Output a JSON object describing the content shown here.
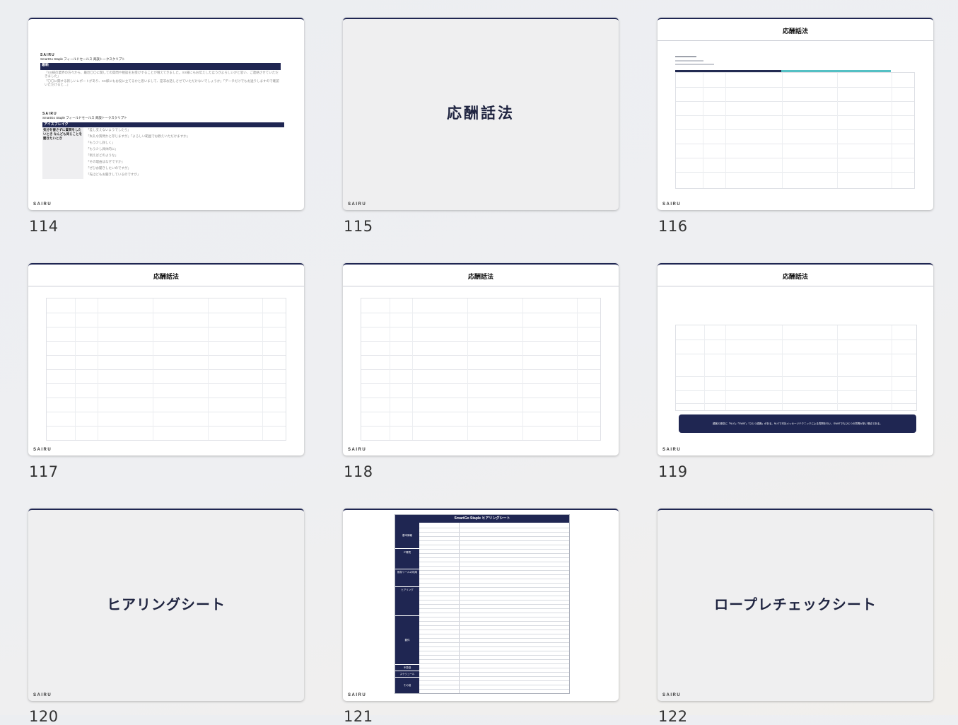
{
  "brand_footer": "SAIRU",
  "slides": [
    {
      "number": "114",
      "sections": [
        {
          "company": "SAIRU",
          "subtitle": "SmartGo Staple フィールドセールス 商談トークスクリプト",
          "bar": "最新",
          "lines": [
            "「XX様の業界の方々から、最近〇〇に関しての質問や相談をお受けすることが増えてきました。XX様にもお伝えしたほうがよろしいかと思い、ご連絡させていただきました」",
            "「〇〇に関する新しいレポートがあり、XX様にもお役に立てるかと思いまして、是非お話しさせていただけないでしょうか」「データだけでもお送りしますので確認いただけると…」"
          ]
        },
        {
          "company": "SAIRU",
          "subtitle": "SmartGo Staple フィールドセールス 商談トークスクリプト",
          "bar": "アイスブレイク",
          "side": "気分を害さずに質問をしたいとき なんども同じことを聞きたいとき",
          "lines": [
            "「差し支えないようでしたら」",
            "「失礼な質問かと存じますが」「よろしい範囲でお教えいただけますか」",
            "「もう少し詳しく」",
            "「もう少し具体的に」",
            "「例えばどのような」",
            "「その理由はなぜですか」",
            "「ぜひお聞きしたいのですが」",
            "「先ほどもお聞きしているのですが」"
          ]
        }
      ]
    },
    {
      "number": "115",
      "title": "応酬話法"
    },
    {
      "number": "116",
      "header": "応酬話法"
    },
    {
      "number": "117",
      "header": "応酬話法"
    },
    {
      "number": "118",
      "header": "応酬話法"
    },
    {
      "number": "119",
      "header": "応酬話法",
      "banner": "顧客の懸念に「NLO」「SWAT」「ひとつ認識」がある。NLOで本社メッセージテクニックによる質問を行い、SWATでもひとつの質問が多い場合である。"
    },
    {
      "number": "120",
      "title": "ヒアリングシート"
    },
    {
      "number": "121",
      "sheet_title": "SmartGo Staple ヒアリングシート",
      "sections": [
        "基本情報",
        "IT環境",
        "既存ツールの利用",
        "ヒアリング",
        "要件",
        "予算感",
        "スケジュール",
        "その他"
      ]
    },
    {
      "number": "122",
      "title": "ロープレチェックシート"
    }
  ]
}
